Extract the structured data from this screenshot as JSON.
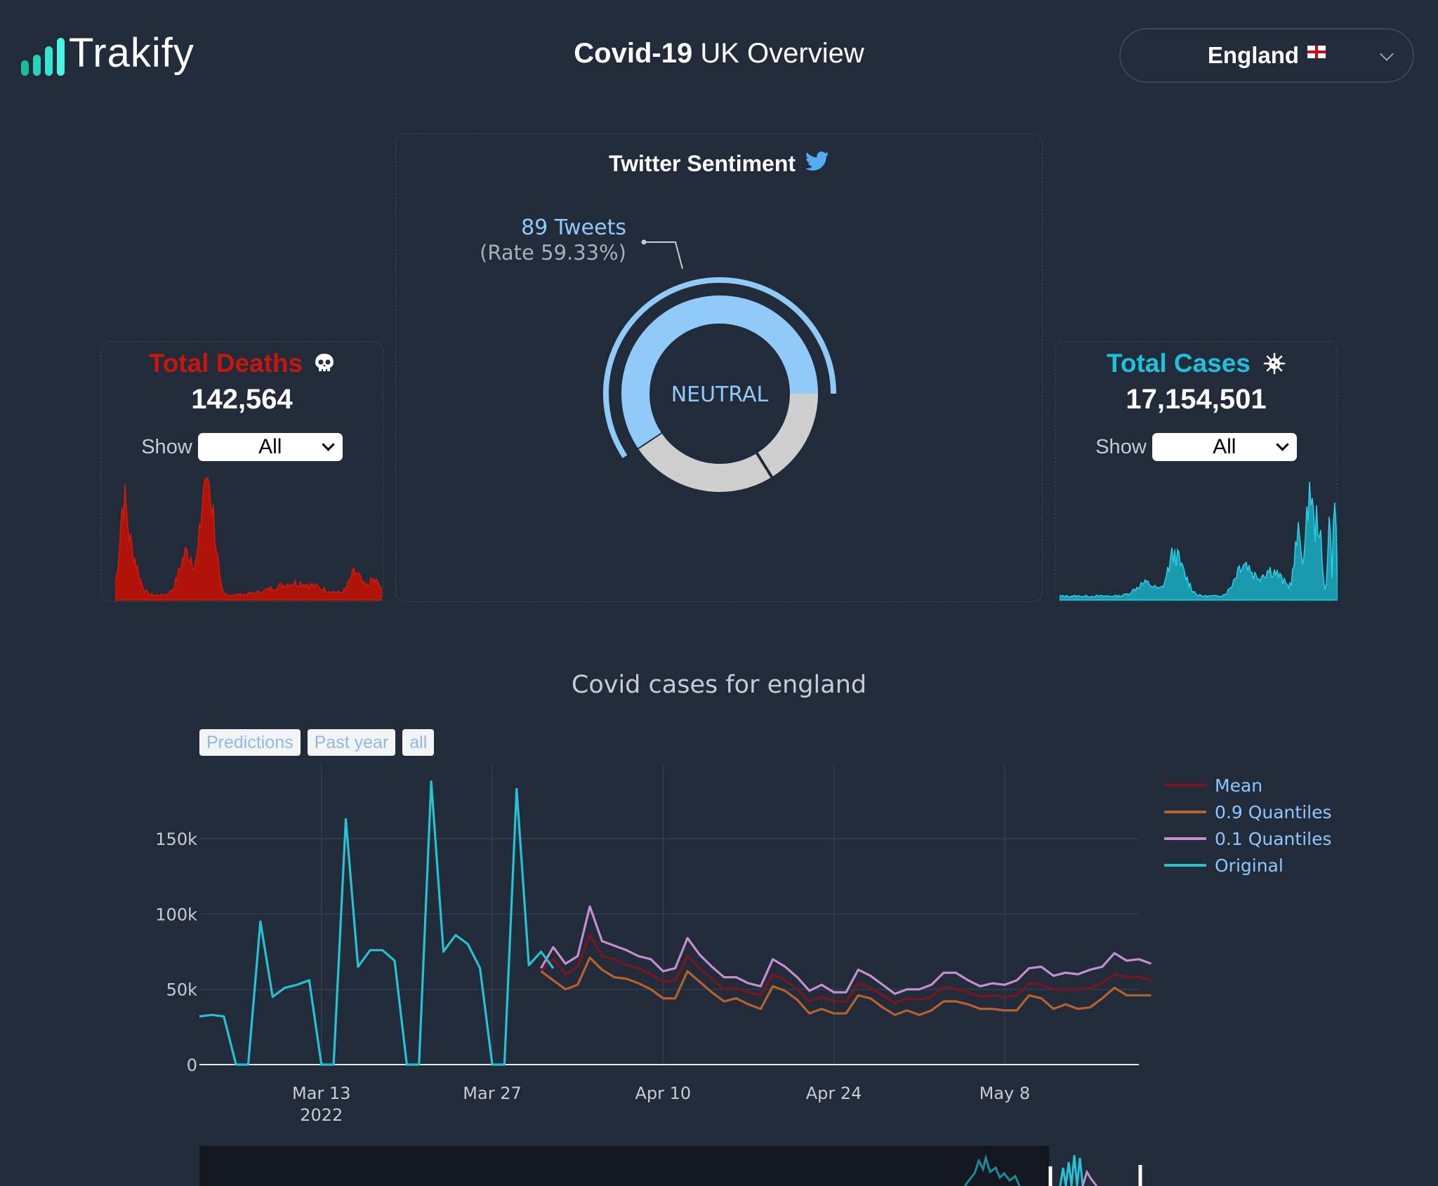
{
  "header": {
    "app_name": "Trakify",
    "title_bold": "Covid-19",
    "title_rest": " UK Overview",
    "region": "England",
    "logo_colors": [
      "#1fb9a0",
      "#28d2b8",
      "#35e6d0",
      "#48f5e2"
    ]
  },
  "deaths": {
    "title": "Total Deaths",
    "icon": "skull-icon",
    "value": "142,564",
    "show_label": "Show",
    "show_value": "All",
    "color": "#c6160e"
  },
  "cases": {
    "title": "Total Cases",
    "icon": "virus-icon",
    "value": "17,154,501",
    "show_label": "Show",
    "show_value": "All",
    "color": "#1ec1dc"
  },
  "sentiment": {
    "title": "Twitter Sentiment",
    "icon": "twitter-icon",
    "center_label": "NEUTRAL",
    "callout_count": "89 Tweets",
    "callout_rate": "(Rate 59.33%)",
    "share_neutral": 0.5933,
    "colors": {
      "neutral": "#90caf9",
      "other": "#cfcfcf"
    }
  },
  "main_chart": {
    "title": "Covid cases for england",
    "range_buttons": [
      "Predictions",
      "Past year",
      "all"
    ],
    "legend": [
      {
        "name": "Mean",
        "color": "#7a1520"
      },
      {
        "name": "0.9 Quantiles",
        "color": "#b8612a"
      },
      {
        "name": "0.1 Quantiles",
        "color": "#c58fce"
      },
      {
        "name": "Original",
        "color": "#26c2d4"
      }
    ],
    "x_ticks": [
      {
        "label": "Mar 13",
        "sub": "2022"
      },
      {
        "label": "Apr 10",
        "sub": ""
      },
      {
        "label": "Apr 24",
        "sub": ""
      },
      {
        "label": "May 8",
        "sub": ""
      }
    ],
    "x_tick_mar27": "Mar 27",
    "y_ticks": [
      "0",
      "50k",
      "100k",
      "150k"
    ]
  },
  "chart_data": {
    "type": "line",
    "title": "Covid cases for england",
    "xlabel": "",
    "ylabel": "",
    "x_range": [
      "2022-03-03",
      "2022-05-19"
    ],
    "ylim": [
      0,
      199000
    ],
    "grid": true,
    "legend_position": "top-right",
    "series": [
      {
        "name": "Original",
        "x": [
          "2022-03-03",
          "2022-03-04",
          "2022-03-05",
          "2022-03-06",
          "2022-03-07",
          "2022-03-08",
          "2022-03-09",
          "2022-03-10",
          "2022-03-11",
          "2022-03-12",
          "2022-03-13",
          "2022-03-14",
          "2022-03-15",
          "2022-03-16",
          "2022-03-17",
          "2022-03-18",
          "2022-03-19",
          "2022-03-20",
          "2022-03-21",
          "2022-03-22",
          "2022-03-23",
          "2022-03-24",
          "2022-03-25",
          "2022-03-26",
          "2022-03-27",
          "2022-03-28",
          "2022-03-29",
          "2022-03-30",
          "2022-03-31",
          "2022-04-01",
          "2022-04-02"
        ],
        "values": [
          32000,
          33000,
          32000,
          0,
          0,
          95000,
          45000,
          51000,
          53000,
          56000,
          0,
          0,
          163000,
          65000,
          76000,
          76000,
          69000,
          0,
          0,
          188000,
          75000,
          86000,
          80000,
          64000,
          0,
          0,
          183000,
          66000,
          75000,
          64000,
          0
        ]
      },
      {
        "name": "0.1 Quantiles",
        "x_start": "2022-03-31",
        "values": [
          64000,
          78000,
          67000,
          72000,
          105000,
          82000,
          79000,
          76000,
          72000,
          70000,
          62000,
          64000,
          84000,
          73000,
          65000,
          58000,
          58000,
          54000,
          52000,
          70000,
          65000,
          58000,
          49000,
          53000,
          48000,
          48000,
          63000,
          59000,
          53000,
          47000,
          50000,
          50000,
          53000,
          61000,
          61000,
          56000,
          52000,
          54000,
          53000,
          56000,
          64000,
          65000,
          59000,
          61000,
          60000,
          63000,
          65000,
          74000,
          69000,
          70000,
          67000
        ]
      },
      {
        "name": "Mean",
        "x_start": "2022-03-31",
        "values": [
          62000,
          70000,
          60000,
          65000,
          86000,
          72000,
          70000,
          66000,
          64000,
          60000,
          55000,
          56000,
          72000,
          64000,
          57000,
          50000,
          51000,
          48000,
          46000,
          60000,
          56000,
          50000,
          42000,
          45000,
          42000,
          42000,
          54000,
          51000,
          46000,
          41000,
          44000,
          43000,
          45000,
          52000,
          50000,
          48000,
          45000,
          46000,
          45000,
          46000,
          54000,
          53000,
          50000,
          50000,
          50000,
          51000,
          54000,
          60000,
          58000,
          58000,
          56000
        ]
      },
      {
        "name": "0.9 Quantiles",
        "x_start": "2022-03-31",
        "values": [
          62000,
          56000,
          50000,
          53000,
          71000,
          63000,
          58000,
          57000,
          54000,
          50000,
          44000,
          44000,
          62000,
          55000,
          48000,
          42000,
          44000,
          40000,
          37000,
          52000,
          49000,
          43000,
          34000,
          37000,
          34000,
          34000,
          46000,
          44000,
          38000,
          33000,
          36000,
          33000,
          36000,
          42000,
          42000,
          40000,
          37000,
          37000,
          36000,
          36000,
          46000,
          44000,
          37000,
          40000,
          37000,
          38000,
          44000,
          51000,
          46000,
          46000,
          46000
        ]
      }
    ]
  }
}
